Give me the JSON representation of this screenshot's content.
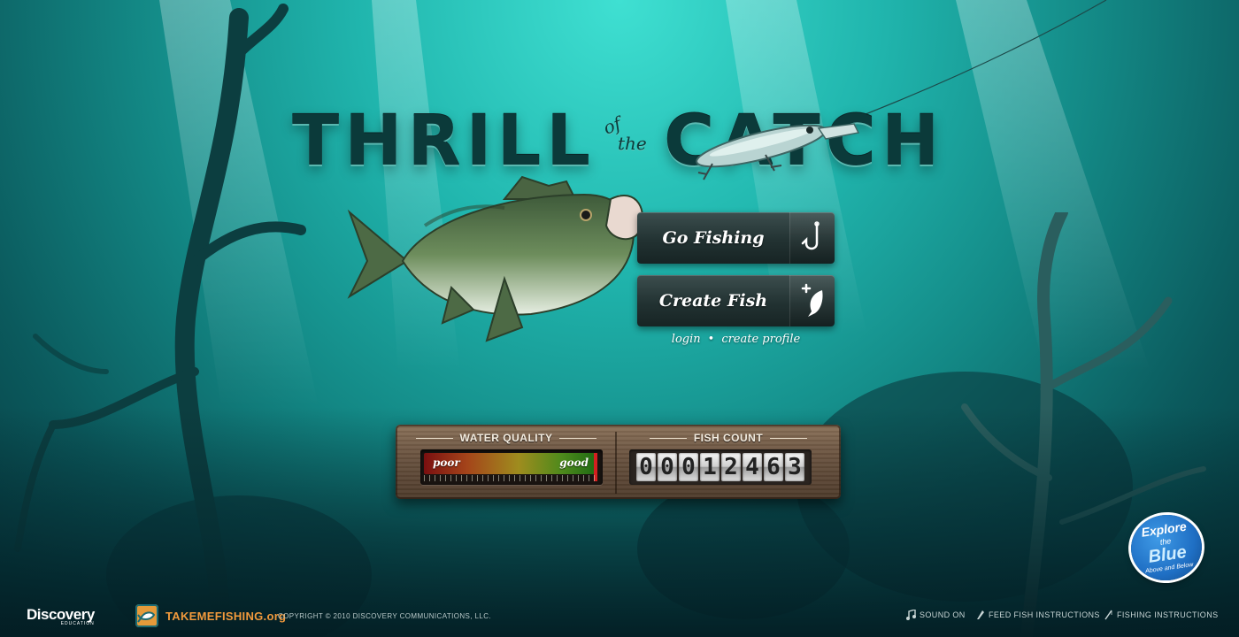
{
  "title": {
    "thrill": "THRILL",
    "of": "of",
    "the": "the",
    "catch": "CATCH"
  },
  "buttons": {
    "go_fishing": "Go Fishing",
    "create_fish": "Create Fish"
  },
  "auth_links": {
    "login": "login",
    "separator": "•",
    "create_profile": "create profile"
  },
  "water_quality": {
    "label": "WATER QUALITY",
    "low_label": "poor",
    "high_label": "good",
    "level": 0.98
  },
  "fish_count": {
    "label": "FISH COUNT",
    "digits": [
      "0",
      "0",
      "0",
      "1",
      "2",
      "4",
      "6",
      "3"
    ]
  },
  "badge": {
    "line1": "Explore",
    "line2": "the",
    "line3": "Blue",
    "line4": "Above and Below"
  },
  "footer": {
    "discovery": "Discovery",
    "discovery_sub": "EDUCATION",
    "takemefishing": "TAKEMEFISHING.org",
    "copyright": "COPYRIGHT © 2010 DISCOVERY COMMUNICATIONS, LLC.",
    "sound": "SOUND ON",
    "feed": "FEED FISH INSTRUCTIONS",
    "instructions": "FISHING INSTRUCTIONS"
  },
  "colors": {
    "water_top": "#3fe0d2",
    "water_deep": "#06373d",
    "button": "#223232",
    "footer_orange": "#f29a3c"
  },
  "icons": {
    "go_fishing": "fishing-hook-icon",
    "create_fish": "add-fish-icon",
    "sound": "music-note-icon",
    "feed": "feed-icon",
    "instructions": "rod-icon"
  }
}
